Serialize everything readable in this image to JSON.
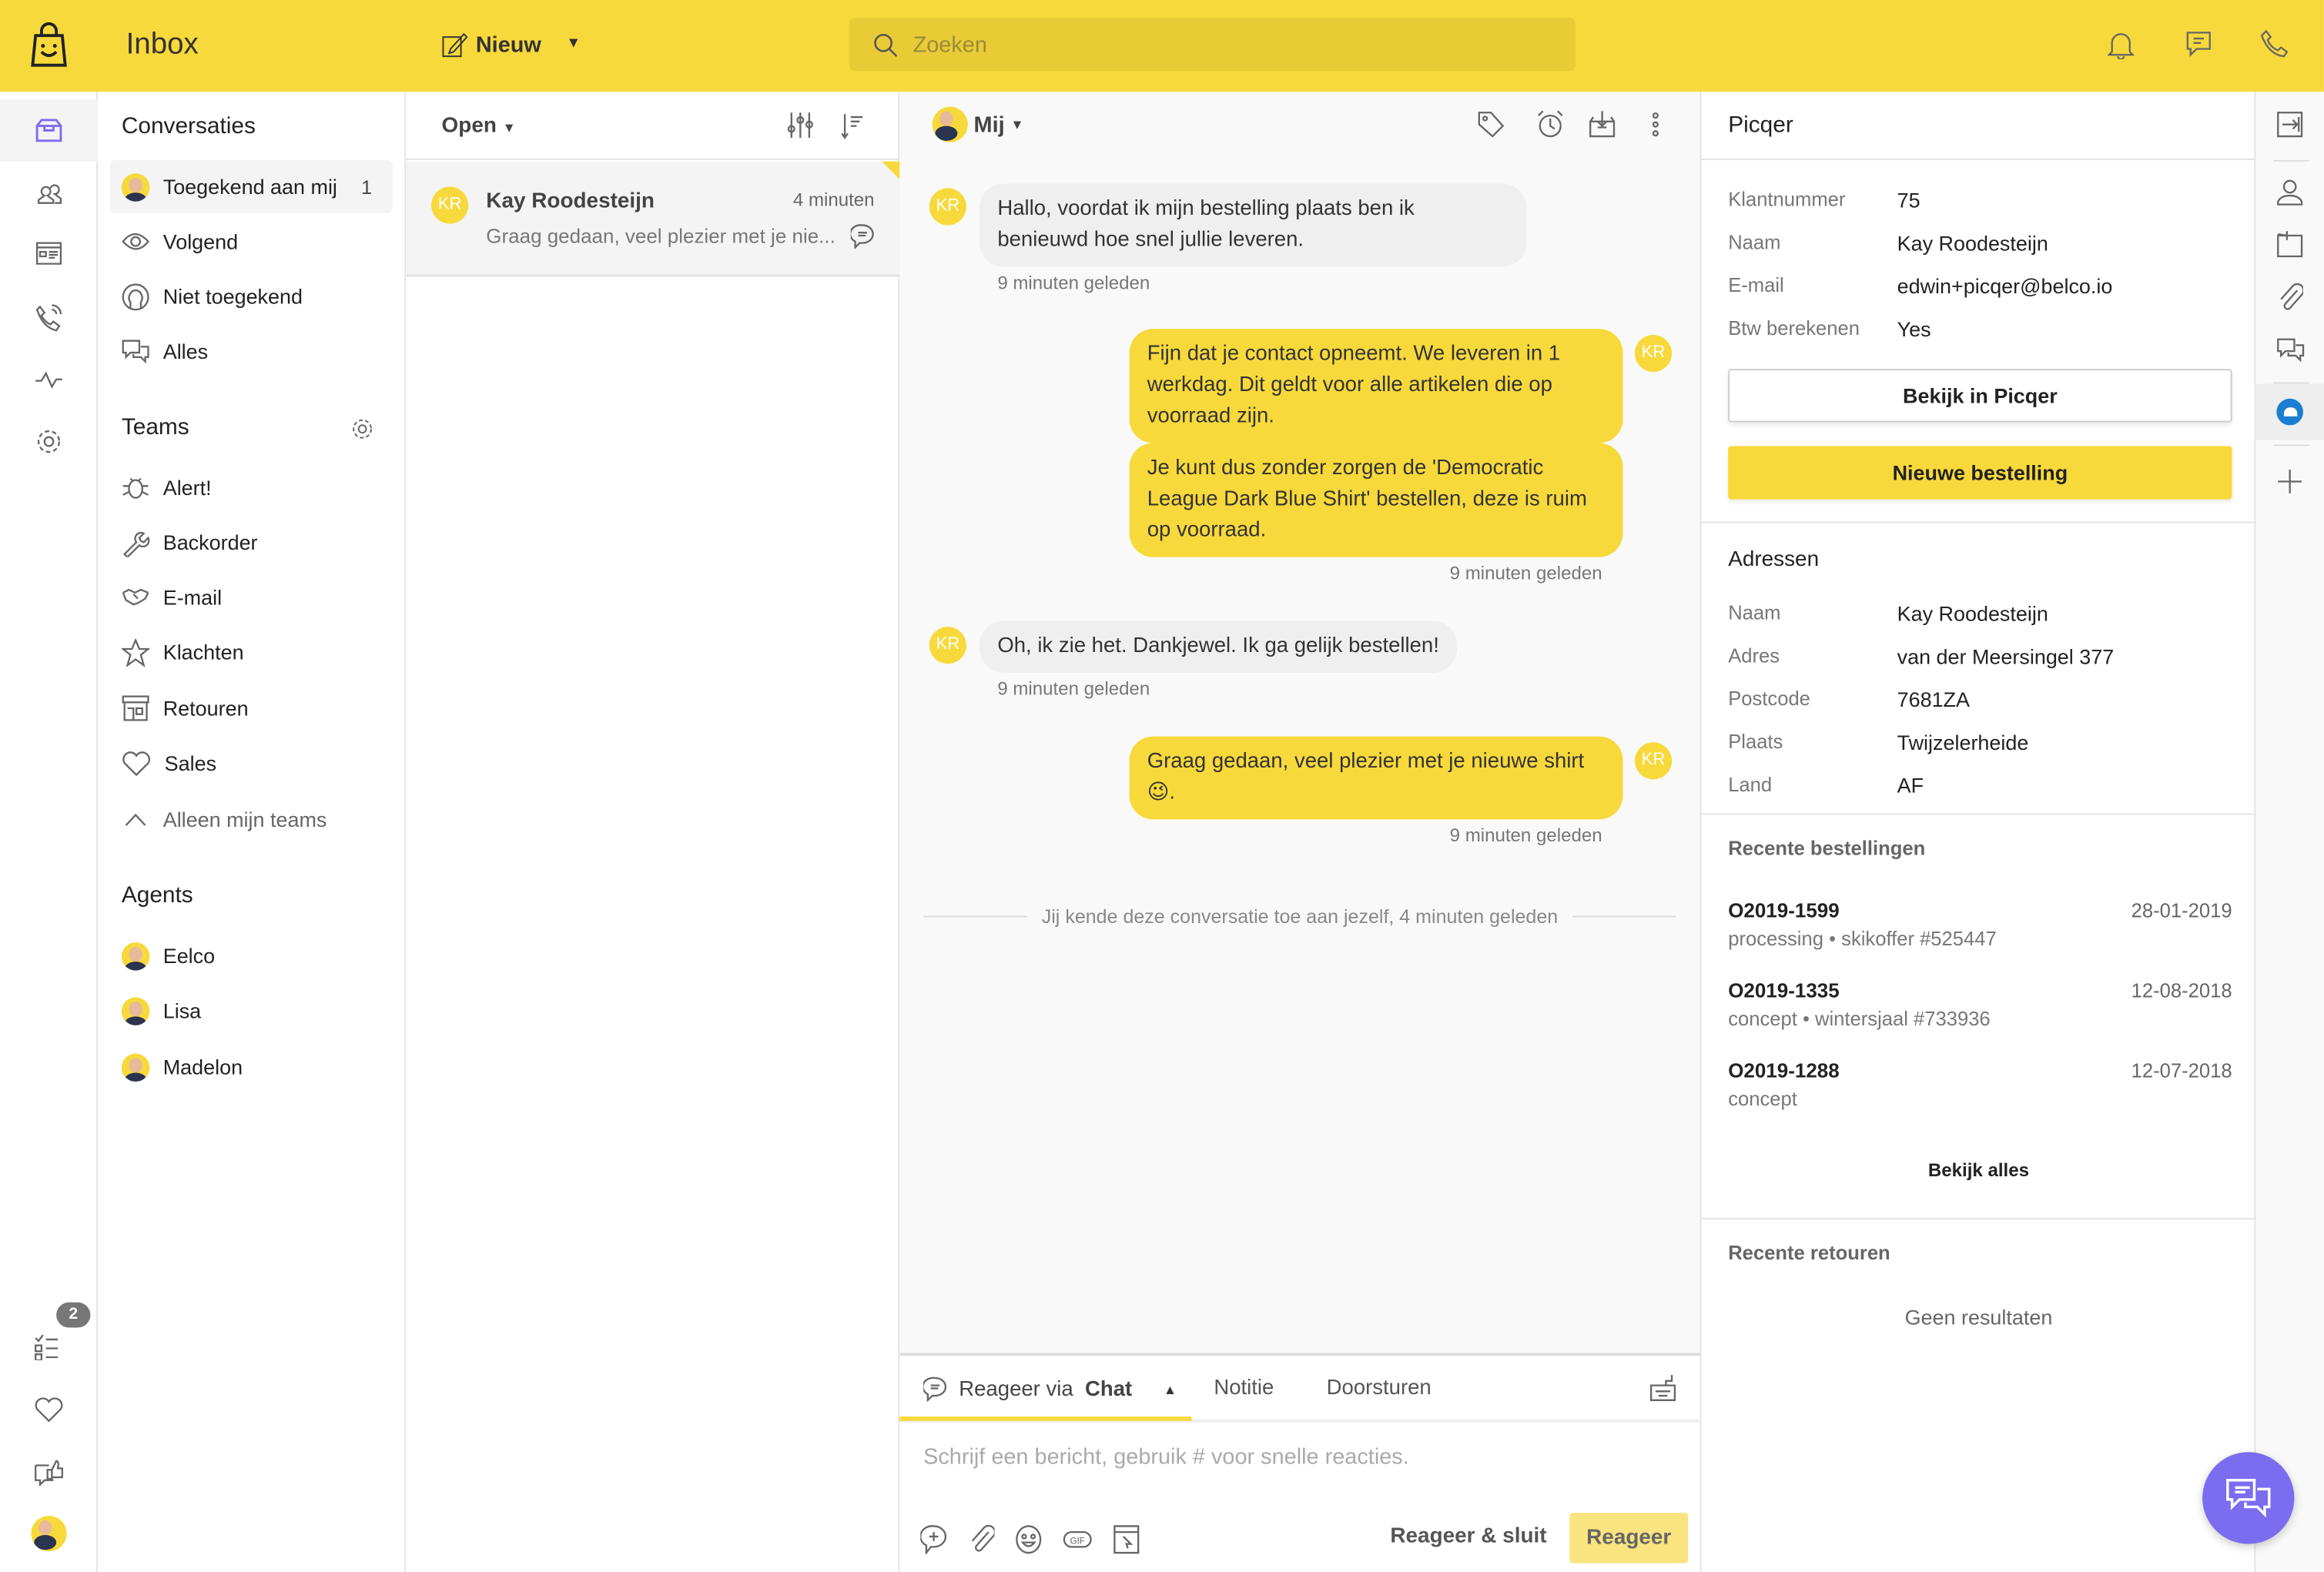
{
  "header": {
    "title": "Inbox",
    "new_label": "Nieuw",
    "search_placeholder": "Zoeken"
  },
  "rail": {
    "tasks_badge": "2"
  },
  "sidebar": {
    "conversations_title": "Conversaties",
    "items": [
      {
        "label": "Toegekend aan mij",
        "count": "1"
      },
      {
        "label": "Volgend"
      },
      {
        "label": "Niet toegekend"
      },
      {
        "label": "Alles"
      }
    ],
    "teams_title": "Teams",
    "teams": [
      {
        "label": "Alert!",
        "icon": "bug-icon"
      },
      {
        "label": "Backorder",
        "icon": "wrench-icon"
      },
      {
        "label": "E-mail",
        "icon": "handshake-icon"
      },
      {
        "label": "Klachten",
        "icon": "star-icon"
      },
      {
        "label": "Retouren",
        "icon": "store-icon"
      },
      {
        "label": "Sales",
        "icon": "heart-icon"
      }
    ],
    "only_my_teams": "Alleen mijn teams",
    "agents_title": "Agents",
    "agents": [
      {
        "label": "Eelco"
      },
      {
        "label": "Lisa"
      },
      {
        "label": "Madelon"
      }
    ]
  },
  "list": {
    "filter": "Open",
    "conversation": {
      "initials": "KR",
      "name": "Kay Roodesteijn",
      "time": "4 minuten",
      "preview": "Graag gedaan, veel plezier met je nie..."
    }
  },
  "chat": {
    "assignee": "Mij",
    "messages": [
      {
        "side": "in",
        "initials": "KR",
        "bubbles": [
          "Hallo, voordat ik mijn bestelling plaats ben ik benieuwd hoe snel jullie leveren."
        ],
        "time": "9 minuten geleden"
      },
      {
        "side": "out",
        "initials": "KR",
        "bubbles": [
          "Fijn dat je contact opneemt. We leveren in 1 werkdag. Dit geldt voor alle artikelen die op voorraad zijn.",
          "Je kunt dus zonder zorgen de 'Democratic League Dark Blue Shirt' bestellen, deze is ruim op voorraad."
        ],
        "time": "9 minuten geleden"
      },
      {
        "side": "in",
        "initials": "KR",
        "bubbles": [
          "Oh, ik zie het. Dankjewel. Ik ga gelijk bestellen!"
        ],
        "time": "9 minuten geleden"
      },
      {
        "side": "out",
        "initials": "KR",
        "bubbles": [
          "Graag gedaan, veel plezier met je nieuwe shirt 😉."
        ],
        "time": "9 minuten geleden"
      }
    ],
    "system_note": "Jij kende deze conversatie toe aan jezelf, 4 minuten geleden"
  },
  "composer": {
    "tab_reply_prefix": "Reageer via",
    "tab_reply_channel": "Chat",
    "tab_note": "Notitie",
    "tab_forward": "Doorsturen",
    "placeholder": "Schrijf een bericht, gebruik # voor snelle reacties.",
    "reply_close": "Reageer & sluit",
    "reply": "Reageer"
  },
  "panel": {
    "title": "Picqer",
    "customer": [
      {
        "key": "Klantnummer",
        "value": "75"
      },
      {
        "key": "Naam",
        "value": "Kay Roodesteijn"
      },
      {
        "key": "E-mail",
        "value": "edwin+picqer@belco.io"
      },
      {
        "key": "Btw berekenen",
        "value": "Yes"
      }
    ],
    "view_button": "Bekijk in Picqer",
    "new_order_button": "Nieuwe bestelling",
    "addresses_title": "Adressen",
    "address": [
      {
        "key": "Naam",
        "value": "Kay Roodesteijn"
      },
      {
        "key": "Adres",
        "value": "van der Meersingel 377"
      },
      {
        "key": "Postcode",
        "value": "7681ZA"
      },
      {
        "key": "Plaats",
        "value": "Twijzelerheide"
      },
      {
        "key": "Land",
        "value": "AF"
      }
    ],
    "orders_title": "Recente bestellingen",
    "orders": [
      {
        "id": "O2019-1599",
        "date": "28-01-2019",
        "sub": "processing • skikoffer #525447"
      },
      {
        "id": "O2019-1335",
        "date": "12-08-2018",
        "sub": "concept • wintersjaal #733936"
      },
      {
        "id": "O2019-1288",
        "date": "12-07-2018",
        "sub": "concept"
      }
    ],
    "view_all": "Bekijk alles",
    "returns_title": "Recente retouren",
    "no_results": "Geen resultaten"
  },
  "colors": {
    "brand_yellow": "#f8d93b",
    "chat_fab": "#7b6cf0",
    "picqer_blue": "#1a7fd0"
  }
}
